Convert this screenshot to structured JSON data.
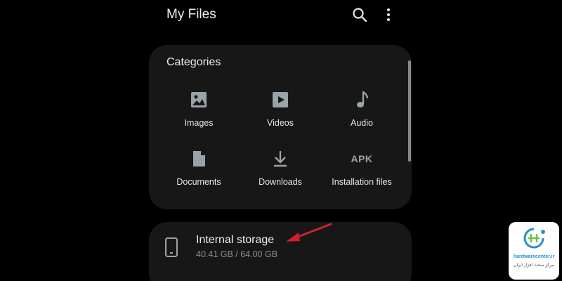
{
  "header": {
    "title": "My Files",
    "search_icon": "search-icon",
    "more_icon": "more-vertical-icon"
  },
  "categories": {
    "title": "Categories",
    "items": [
      {
        "label": "Images",
        "icon": "image-icon"
      },
      {
        "label": "Videos",
        "icon": "video-icon"
      },
      {
        "label": "Audio",
        "icon": "music-note-icon"
      },
      {
        "label": "Documents",
        "icon": "document-icon"
      },
      {
        "label": "Downloads",
        "icon": "download-icon"
      },
      {
        "label": "Installation files",
        "icon": "apk-icon",
        "glyph": "APK"
      }
    ]
  },
  "storage": {
    "title": "Internal storage",
    "usage": "40.41 GB / 64.00 GB",
    "icon": "phone-icon"
  },
  "annotation": {
    "icon": "red-arrow-icon",
    "color": "#d0202f"
  },
  "watermark": {
    "site": "hardwarecenter.ir",
    "tagline": "مرکز سخت افزار ایران",
    "icon": "hardwarecenter-logo-icon"
  },
  "colors": {
    "background": "#000000",
    "card": "#171717",
    "icon": "#9aa4a8",
    "accent_red": "#d0202f"
  }
}
